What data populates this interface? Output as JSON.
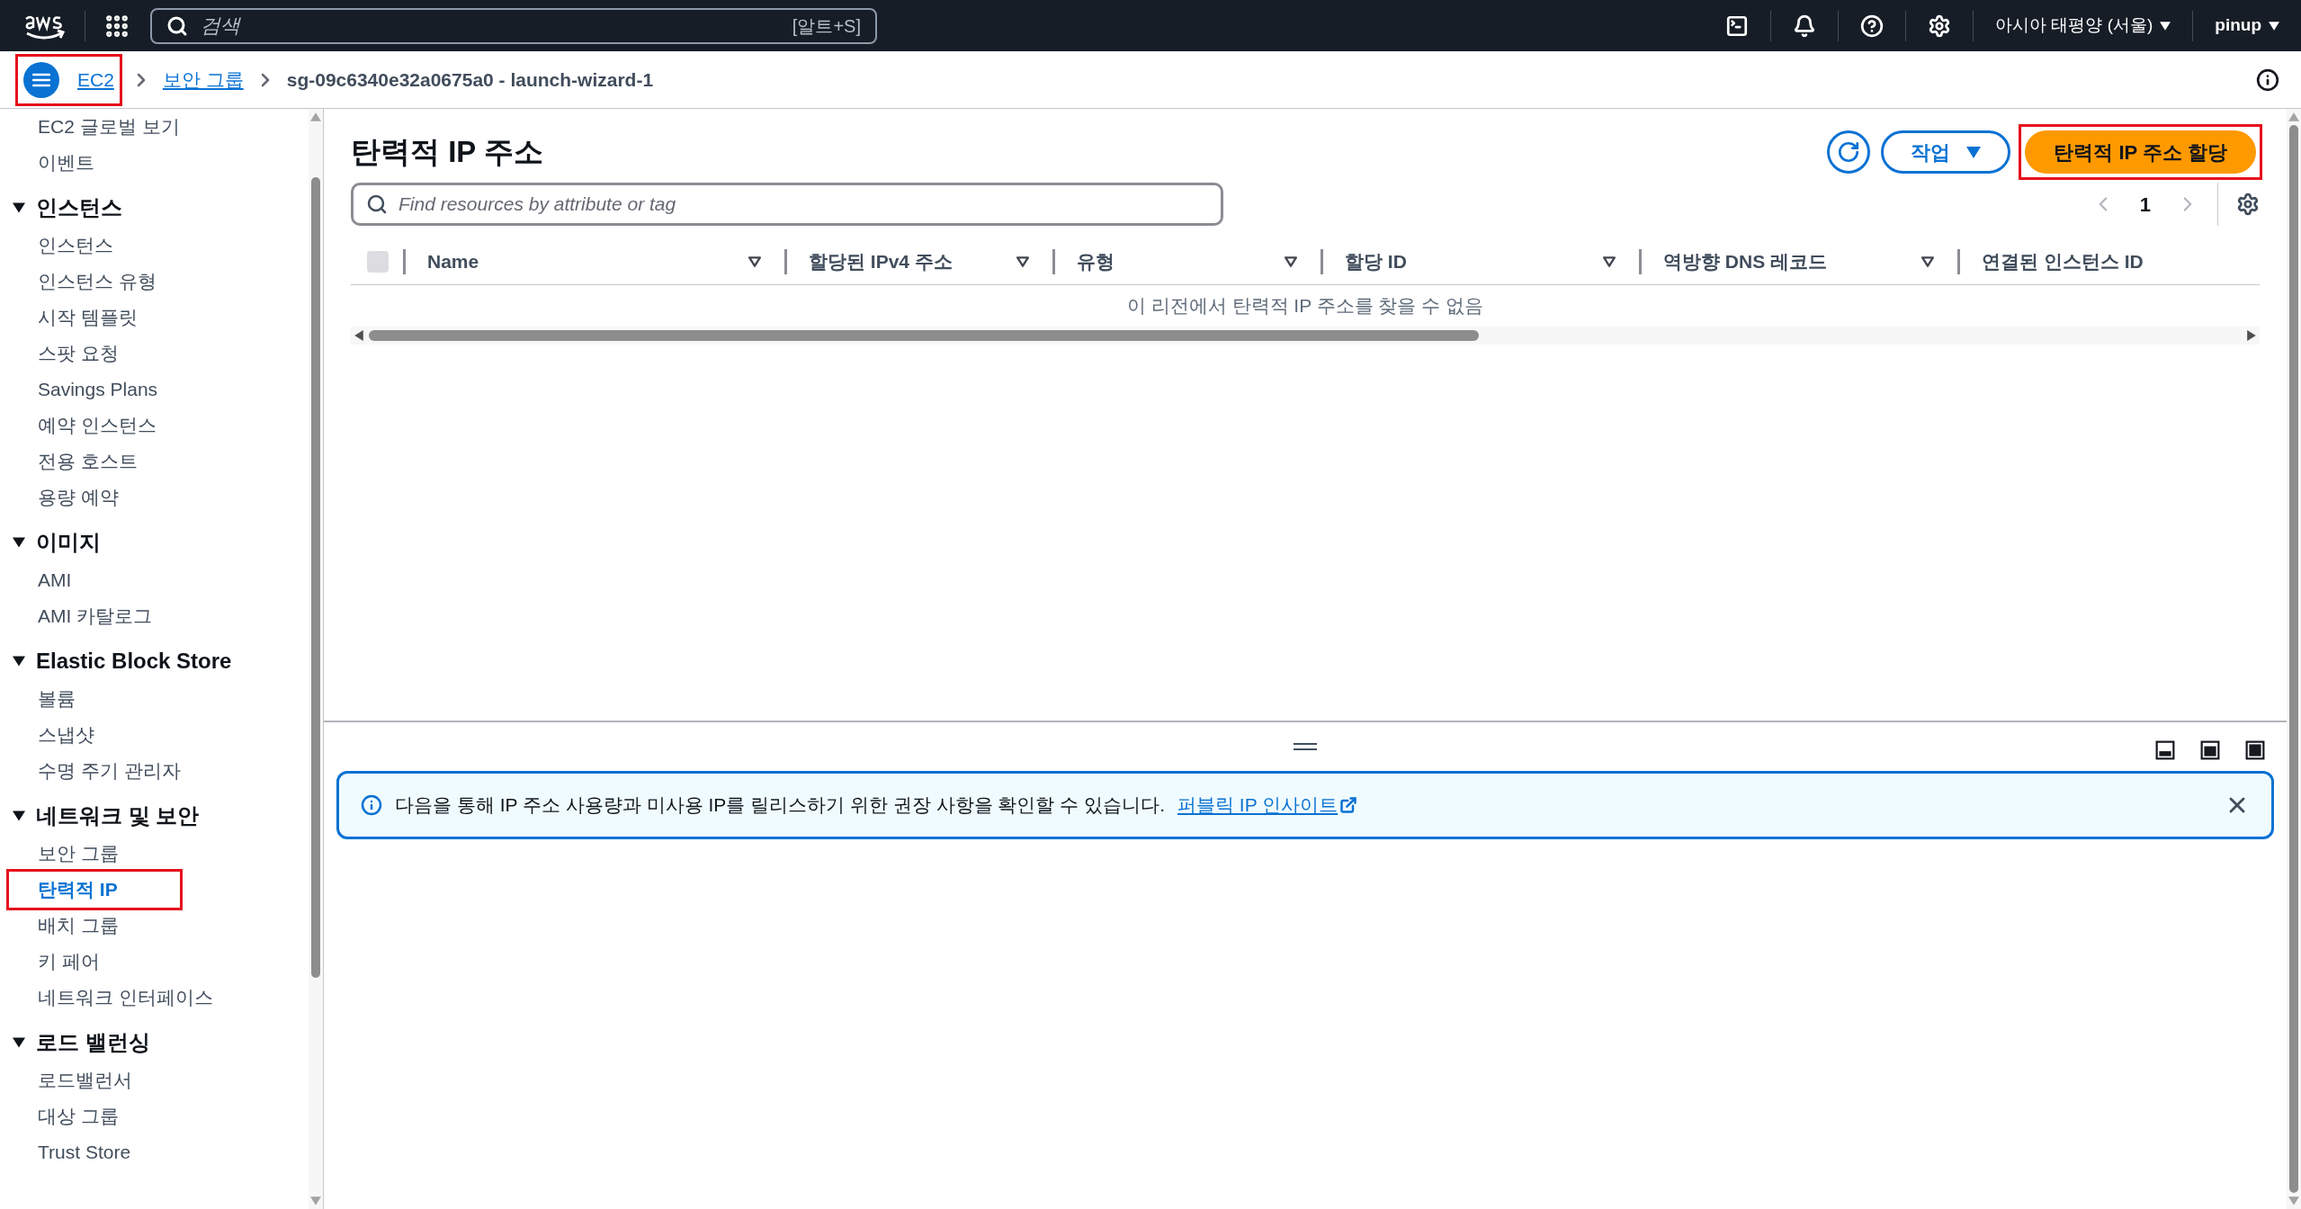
{
  "top_bar": {
    "search": {
      "placeholder": "검색",
      "shortcut": "[알트+S]"
    },
    "region": "아시아 태평양 (서울)",
    "user": "pinup"
  },
  "breadcrumb": {
    "annotated": true,
    "items": [
      {
        "label": "EC2",
        "kind": "link"
      },
      {
        "label": "보안 그룹",
        "kind": "link"
      },
      {
        "label": "sg-09c6340e32a0675a0 - launch-wizard-1",
        "kind": "current"
      }
    ]
  },
  "sidebar": {
    "top_items": [
      {
        "label": "EC2 글로벌 보기",
        "selected": false,
        "annotated": false
      },
      {
        "label": "이벤트",
        "selected": false,
        "annotated": false
      }
    ],
    "sections": [
      {
        "title": "인스턴스",
        "expanded": true,
        "items": [
          {
            "label": "인스턴스",
            "selected": false,
            "annotated": false
          },
          {
            "label": "인스턴스 유형",
            "selected": false,
            "annotated": false
          },
          {
            "label": "시작 템플릿",
            "selected": false,
            "annotated": false
          },
          {
            "label": "스팟 요청",
            "selected": false,
            "annotated": false
          },
          {
            "label": "Savings Plans",
            "selected": false,
            "annotated": false
          },
          {
            "label": "예약 인스턴스",
            "selected": false,
            "annotated": false
          },
          {
            "label": "전용 호스트",
            "selected": false,
            "annotated": false
          },
          {
            "label": "용량 예약",
            "selected": false,
            "annotated": false
          }
        ]
      },
      {
        "title": "이미지",
        "expanded": true,
        "items": [
          {
            "label": "AMI",
            "selected": false,
            "annotated": false
          },
          {
            "label": "AMI 카탈로그",
            "selected": false,
            "annotated": false
          }
        ]
      },
      {
        "title": "Elastic Block Store",
        "expanded": true,
        "items": [
          {
            "label": "볼륨",
            "selected": false,
            "annotated": false
          },
          {
            "label": "스냅샷",
            "selected": false,
            "annotated": false
          },
          {
            "label": "수명 주기 관리자",
            "selected": false,
            "annotated": false
          }
        ]
      },
      {
        "title": "네트워크 및 보안",
        "expanded": true,
        "items": [
          {
            "label": "보안 그룹",
            "selected": false,
            "annotated": false
          },
          {
            "label": "탄력적 IP",
            "selected": true,
            "annotated": true
          },
          {
            "label": "배치 그룹",
            "selected": false,
            "annotated": false
          },
          {
            "label": "키 페어",
            "selected": false,
            "annotated": false
          },
          {
            "label": "네트워크 인터페이스",
            "selected": false,
            "annotated": false
          }
        ]
      },
      {
        "title": "로드 밸런싱",
        "expanded": true,
        "items": [
          {
            "label": "로드밸런서",
            "selected": false,
            "annotated": false
          },
          {
            "label": "대상 그룹",
            "selected": false,
            "annotated": false
          },
          {
            "label": "Trust Store",
            "selected": false,
            "annotated": false
          }
        ]
      }
    ]
  },
  "main": {
    "title": "탄력적 IP 주소",
    "actions_button": "작업",
    "primary_button": {
      "label": "탄력적 IP 주소 할당",
      "annotated": true
    },
    "search": {
      "placeholder": "Find resources by attribute or tag"
    },
    "pagination": {
      "page": "1"
    },
    "table": {
      "select_all": {
        "checked": false,
        "disabled": true
      },
      "columns": [
        "Name",
        "할당된 IPv4 주소",
        "유형",
        "할당 ID",
        "역방향 DNS 레코드",
        "연결된 인스턴스 ID"
      ],
      "empty_message": "이 리전에서 탄력적 IP 주소를 찾을 수 없음"
    }
  },
  "split_panel": {
    "notice": {
      "text": "다음을 통해 IP 주소 사용량과 미사용 IP를 릴리스하기 위한 권장 사항을 확인할 수 있습니다.",
      "link": "퍼블릭 IP 인사이트"
    }
  }
}
